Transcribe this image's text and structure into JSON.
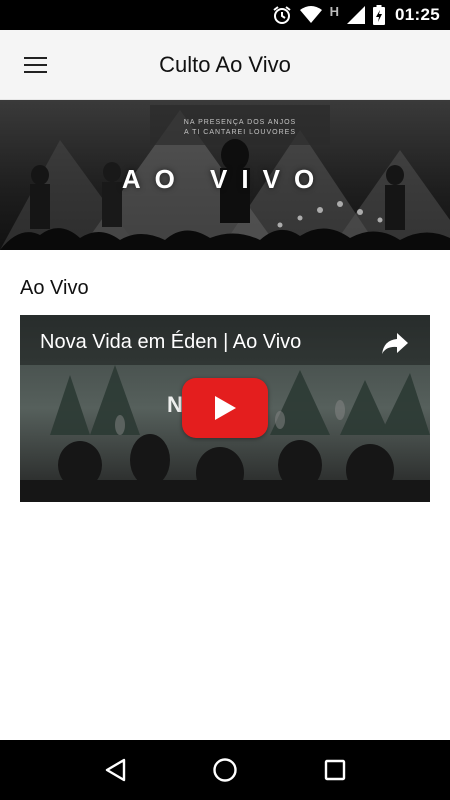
{
  "status_bar": {
    "time": "01:25",
    "network_letter": "H",
    "icons": [
      "alarm-icon",
      "wifi-icon",
      "signal-icon",
      "battery-charging-icon"
    ]
  },
  "app_bar": {
    "title": "Culto Ao Vivo",
    "menu_icon": "hamburger-menu-icon"
  },
  "banner": {
    "text": "AO VIVO",
    "small_text_line1": "NA PRESENÇA DOS ANJOS",
    "small_text_line2": "A TI CANTAREI LOUVORES"
  },
  "section": {
    "heading": "Ao Vivo"
  },
  "video": {
    "title": "Nova Vida em Éden | Ao Vivo",
    "watermark": "N        A",
    "share_icon": "share-icon",
    "play_icon": "play-icon",
    "play_color": "#e41e1e"
  },
  "nav_bar": {
    "icons": [
      "back-icon",
      "home-icon",
      "recents-icon"
    ]
  }
}
